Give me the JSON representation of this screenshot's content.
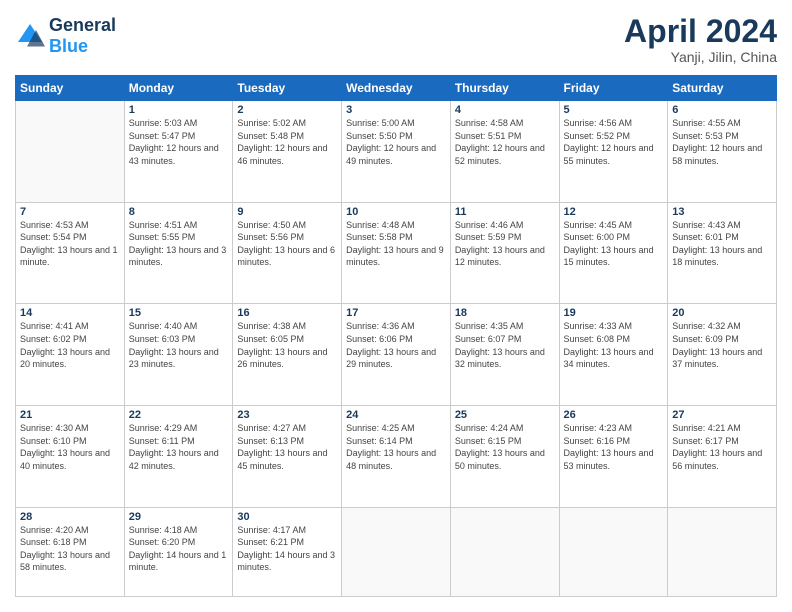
{
  "logo": {
    "text_general": "General",
    "text_blue": "Blue"
  },
  "header": {
    "month": "April 2024",
    "location": "Yanji, Jilin, China"
  },
  "weekdays": [
    "Sunday",
    "Monday",
    "Tuesday",
    "Wednesday",
    "Thursday",
    "Friday",
    "Saturday"
  ],
  "weeks": [
    [
      {
        "day": "",
        "empty": true
      },
      {
        "day": "1",
        "sunrise": "Sunrise: 5:03 AM",
        "sunset": "Sunset: 5:47 PM",
        "daylight": "Daylight: 12 hours and 43 minutes."
      },
      {
        "day": "2",
        "sunrise": "Sunrise: 5:02 AM",
        "sunset": "Sunset: 5:48 PM",
        "daylight": "Daylight: 12 hours and 46 minutes."
      },
      {
        "day": "3",
        "sunrise": "Sunrise: 5:00 AM",
        "sunset": "Sunset: 5:50 PM",
        "daylight": "Daylight: 12 hours and 49 minutes."
      },
      {
        "day": "4",
        "sunrise": "Sunrise: 4:58 AM",
        "sunset": "Sunset: 5:51 PM",
        "daylight": "Daylight: 12 hours and 52 minutes."
      },
      {
        "day": "5",
        "sunrise": "Sunrise: 4:56 AM",
        "sunset": "Sunset: 5:52 PM",
        "daylight": "Daylight: 12 hours and 55 minutes."
      },
      {
        "day": "6",
        "sunrise": "Sunrise: 4:55 AM",
        "sunset": "Sunset: 5:53 PM",
        "daylight": "Daylight: 12 hours and 58 minutes."
      }
    ],
    [
      {
        "day": "7",
        "sunrise": "Sunrise: 4:53 AM",
        "sunset": "Sunset: 5:54 PM",
        "daylight": "Daylight: 13 hours and 1 minute."
      },
      {
        "day": "8",
        "sunrise": "Sunrise: 4:51 AM",
        "sunset": "Sunset: 5:55 PM",
        "daylight": "Daylight: 13 hours and 3 minutes."
      },
      {
        "day": "9",
        "sunrise": "Sunrise: 4:50 AM",
        "sunset": "Sunset: 5:56 PM",
        "daylight": "Daylight: 13 hours and 6 minutes."
      },
      {
        "day": "10",
        "sunrise": "Sunrise: 4:48 AM",
        "sunset": "Sunset: 5:58 PM",
        "daylight": "Daylight: 13 hours and 9 minutes."
      },
      {
        "day": "11",
        "sunrise": "Sunrise: 4:46 AM",
        "sunset": "Sunset: 5:59 PM",
        "daylight": "Daylight: 13 hours and 12 minutes."
      },
      {
        "day": "12",
        "sunrise": "Sunrise: 4:45 AM",
        "sunset": "Sunset: 6:00 PM",
        "daylight": "Daylight: 13 hours and 15 minutes."
      },
      {
        "day": "13",
        "sunrise": "Sunrise: 4:43 AM",
        "sunset": "Sunset: 6:01 PM",
        "daylight": "Daylight: 13 hours and 18 minutes."
      }
    ],
    [
      {
        "day": "14",
        "sunrise": "Sunrise: 4:41 AM",
        "sunset": "Sunset: 6:02 PM",
        "daylight": "Daylight: 13 hours and 20 minutes."
      },
      {
        "day": "15",
        "sunrise": "Sunrise: 4:40 AM",
        "sunset": "Sunset: 6:03 PM",
        "daylight": "Daylight: 13 hours and 23 minutes."
      },
      {
        "day": "16",
        "sunrise": "Sunrise: 4:38 AM",
        "sunset": "Sunset: 6:05 PM",
        "daylight": "Daylight: 13 hours and 26 minutes."
      },
      {
        "day": "17",
        "sunrise": "Sunrise: 4:36 AM",
        "sunset": "Sunset: 6:06 PM",
        "daylight": "Daylight: 13 hours and 29 minutes."
      },
      {
        "day": "18",
        "sunrise": "Sunrise: 4:35 AM",
        "sunset": "Sunset: 6:07 PM",
        "daylight": "Daylight: 13 hours and 32 minutes."
      },
      {
        "day": "19",
        "sunrise": "Sunrise: 4:33 AM",
        "sunset": "Sunset: 6:08 PM",
        "daylight": "Daylight: 13 hours and 34 minutes."
      },
      {
        "day": "20",
        "sunrise": "Sunrise: 4:32 AM",
        "sunset": "Sunset: 6:09 PM",
        "daylight": "Daylight: 13 hours and 37 minutes."
      }
    ],
    [
      {
        "day": "21",
        "sunrise": "Sunrise: 4:30 AM",
        "sunset": "Sunset: 6:10 PM",
        "daylight": "Daylight: 13 hours and 40 minutes."
      },
      {
        "day": "22",
        "sunrise": "Sunrise: 4:29 AM",
        "sunset": "Sunset: 6:11 PM",
        "daylight": "Daylight: 13 hours and 42 minutes."
      },
      {
        "day": "23",
        "sunrise": "Sunrise: 4:27 AM",
        "sunset": "Sunset: 6:13 PM",
        "daylight": "Daylight: 13 hours and 45 minutes."
      },
      {
        "day": "24",
        "sunrise": "Sunrise: 4:25 AM",
        "sunset": "Sunset: 6:14 PM",
        "daylight": "Daylight: 13 hours and 48 minutes."
      },
      {
        "day": "25",
        "sunrise": "Sunrise: 4:24 AM",
        "sunset": "Sunset: 6:15 PM",
        "daylight": "Daylight: 13 hours and 50 minutes."
      },
      {
        "day": "26",
        "sunrise": "Sunrise: 4:23 AM",
        "sunset": "Sunset: 6:16 PM",
        "daylight": "Daylight: 13 hours and 53 minutes."
      },
      {
        "day": "27",
        "sunrise": "Sunrise: 4:21 AM",
        "sunset": "Sunset: 6:17 PM",
        "daylight": "Daylight: 13 hours and 56 minutes."
      }
    ],
    [
      {
        "day": "28",
        "sunrise": "Sunrise: 4:20 AM",
        "sunset": "Sunset: 6:18 PM",
        "daylight": "Daylight: 13 hours and 58 minutes."
      },
      {
        "day": "29",
        "sunrise": "Sunrise: 4:18 AM",
        "sunset": "Sunset: 6:20 PM",
        "daylight": "Daylight: 14 hours and 1 minute."
      },
      {
        "day": "30",
        "sunrise": "Sunrise: 4:17 AM",
        "sunset": "Sunset: 6:21 PM",
        "daylight": "Daylight: 14 hours and 3 minutes."
      },
      {
        "day": "",
        "empty": true
      },
      {
        "day": "",
        "empty": true
      },
      {
        "day": "",
        "empty": true
      },
      {
        "day": "",
        "empty": true
      }
    ]
  ]
}
